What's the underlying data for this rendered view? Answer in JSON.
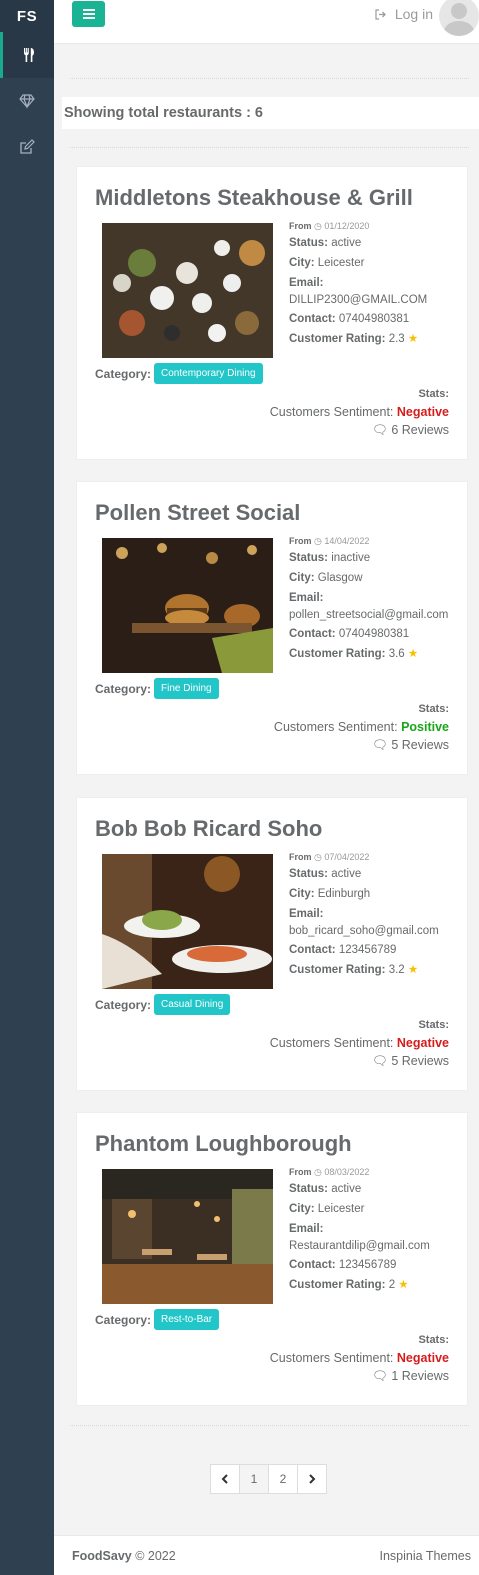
{
  "brand": "FS",
  "header": {
    "logout_label": "Log in"
  },
  "list": {
    "total_label": "Showing total restaurants : ",
    "total_count": "6"
  },
  "labels": {
    "from": "From",
    "status": "Status:",
    "city": "City:",
    "email": "Email:",
    "contact": "Contact:",
    "rating": "Customer Rating:",
    "category": "Category:",
    "stats": "Stats:",
    "sentiment": "Customers Sentiment: "
  },
  "restaurants": [
    {
      "name": "Middletons Steakhouse & Grill",
      "from_date": "01/12/2020",
      "status": "active",
      "city": "Leicester",
      "email": "DILLIP2300@GMAIL.COM",
      "contact": "07404980381",
      "rating": "2.3",
      "category": "Contemporary Dining",
      "sentiment": "Negative",
      "reviews": "6 Reviews"
    },
    {
      "name": "Pollen Street Social",
      "from_date": "14/04/2022",
      "status": "inactive",
      "city": "Glasgow",
      "email": "pollen_streetsocial@gmail.com",
      "contact": "07404980381",
      "rating": "3.6",
      "category": "Fine Dining",
      "sentiment": "Positive",
      "reviews": "5 Reviews"
    },
    {
      "name": "Bob Bob Ricard Soho",
      "from_date": "07/04/2022",
      "status": "active",
      "city": "Edinburgh",
      "email": "bob_ricard_soho@gmail.com",
      "contact": "123456789",
      "rating": "3.2",
      "category": "Casual Dining",
      "sentiment": "Negative",
      "reviews": "5 Reviews"
    },
    {
      "name": "Phantom Loughborough",
      "from_date": "08/03/2022",
      "status": "active",
      "city": "Leicester",
      "email": "Restaurantdilip@gmail.com",
      "contact": "123456789",
      "rating": "2",
      "category": "Rest-to-Bar",
      "sentiment": "Negative",
      "reviews": "1 Reviews"
    }
  ],
  "pagination": {
    "pages": [
      "1",
      "2"
    ]
  },
  "footer": {
    "brand": "FoodSavy",
    "copyright": " © 2022",
    "credit": "Inspinia Themes"
  },
  "colors": {
    "sidebar": "#2f4050",
    "accent": "#1ab394",
    "badge": "#23c6c8",
    "negative": "#d61c1c",
    "positive": "#1aa61a",
    "star": "#f8c000"
  }
}
